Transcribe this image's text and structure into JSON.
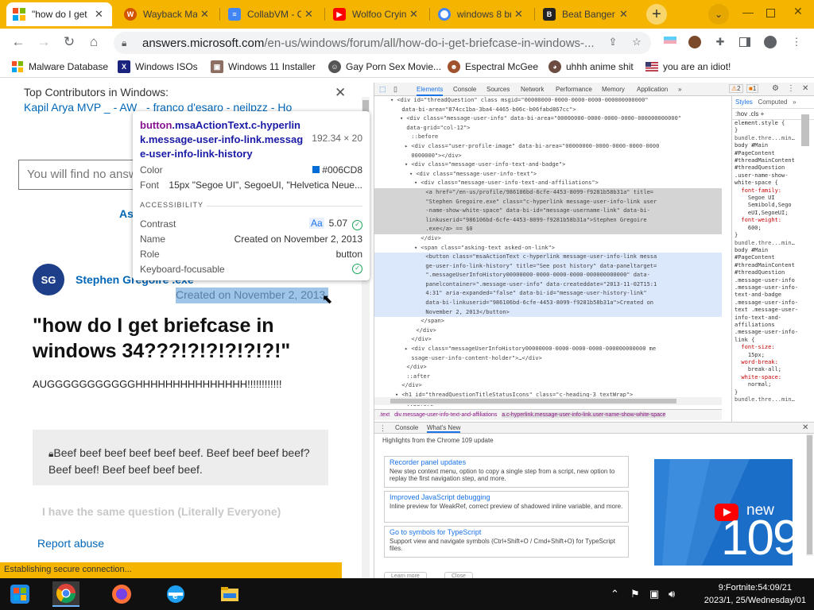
{
  "tabs": [
    {
      "label": "\"how do I get",
      "icon": "microsoft-logo-icon",
      "color": "#f25022",
      "active": true
    },
    {
      "label": "Wayback Ma",
      "icon": "wayback-icon",
      "color": "#d35400"
    },
    {
      "label": "CollabVM - C",
      "icon": "docs-icon",
      "color": "#4285f4"
    },
    {
      "label": "Wolfoo Cryin",
      "icon": "youtube-icon",
      "color": "#ff0000"
    },
    {
      "label": "windows 8 br",
      "icon": "chrome-icon",
      "color": "#4285f4"
    },
    {
      "label": "Beat Banger",
      "icon": "beat-banger-icon",
      "color": "#222222"
    }
  ],
  "toolbar": {
    "url_host": "answers.microsoft.com",
    "url_path": "/en-us/windows/forum/all/how-do-i-get-briefcase-in-windows-..."
  },
  "bookmarks": [
    {
      "label": "Malware Database",
      "icon": "windows-logo-icon"
    },
    {
      "label": "Windows ISOs",
      "icon": "x-icon"
    },
    {
      "label": "Windows 11 Installer",
      "icon": "installer-icon"
    },
    {
      "label": "Gay Porn Sex Movie...",
      "icon": "gay-porn-sex-movie-icon"
    },
    {
      "label": "Espectral McGee",
      "icon": "face-icon"
    },
    {
      "label": "uhhh anime shit",
      "icon": "anime-icon"
    },
    {
      "label": "you are an idiot!",
      "icon": "flag-icon"
    }
  ],
  "page": {
    "contributors_heading": "Top Contributors in Windows:",
    "contributors_links": "Kapil Arya MVP _ - AW_ - franco d'esaro - neilpzz - Ho",
    "search_placeholder": "You will find no answ",
    "ask_label": "As",
    "avatar_initials": "SG",
    "author": "Stephen Gregoire .exe",
    "created": "Created on November 2, 2013",
    "question_title": "\"how do I get briefcase in windows 34???!?!?!?!?!?!\"",
    "question_body": "AUGGGGGGGGGGGHHHHHHHHHHHHHHH!!!!!!!!!!!!",
    "quote": "Beef beef beef beef beef beef. Beef beef beef beef? Beef beef! Beef beef beef beef.",
    "same_question": "I have the same question (Literally Everyone)",
    "report": "Report abuse"
  },
  "status_bar": "Establishing secure connection...",
  "tooltip": {
    "selector_tag": "button",
    "selector_class": ".msaActionText.c-hyperlink.message-user-info-link.message-user-info-link-history",
    "dims": "192.34 × 20",
    "color_label": "Color",
    "color_value": "#006CD8",
    "font_label": "Font",
    "font_value": "15px \"Segoe UI\", SegoeUI, \"Helvetica Neue...",
    "accessibility_heading": "ACCESSIBILITY",
    "contrast_label": "Contrast",
    "contrast_aa": "Aa",
    "contrast_value": "5.07",
    "name_label": "Name",
    "name_value": "Created on November 2, 2013",
    "role_label": "Role",
    "role_value": "button",
    "keyboard_label": "Keyboard-focusable"
  },
  "devtools": {
    "tabs": [
      "Elements",
      "Console",
      "Sources",
      "Network",
      "Performance",
      "Memory",
      "Application",
      "»"
    ],
    "issues": "2",
    "warnings": "1",
    "styles_tabs": [
      "Styles",
      "Computed",
      "»"
    ],
    "styles_filter": ":hov .cls +",
    "element_lines": [
      "<div id=\"threadQuestion\" class msgid=\"00000000-0000-0000-0000-000000000000\"",
      "data-bi-area=\"874cc1ba-3ba4-4465-b06c-b06fabd867cc\">",
      "<div class=\"message-user-info\" data-bi-area=\"00000000-0000-0000-0000-000000000000\"",
      "data-grid=\"col-12\">",
      "::before",
      "<div class=\"user-profile-image\" data-bi-area=\"00000000-0000-0000-0000-0000",
      "0000000\"></div>",
      "<div class=\"message-user-info-text-and-badge\">",
      "<div class=\"message-user-info-text\">",
      "<div class=\"message-user-info-text-and-affiliations\">",
      "<a href=\"/en-us/profile/986106bd-6cfe-4453-8099-f9281b58b31a\" title=",
      "\"Stephen Gregoire.exe\" class=\"c-hyperlink message-user-info-link user",
      "-name-show-white-space\" data-bi-id=\"message-username-link\" data-bi-",
      "linkuserid=\"986106bd-6cfe-4453-8099-f9281b58b31a\">Stephen Gregoire",
      ".exe</a> == $0",
      "</div>",
      "<span class=\"asking-text asked-on-link\">",
      "<button class=\"msaActionText c-hyperlink message-user-info-link messa",
      "ge-user-info-link-history\" title=\"See post history\" data-paneltarget=",
      "\".messageUserInfoHistory00000000-0000-0000-0000-000000000000\" data-",
      "panelcontainer=\".message-user-info\" data-createddate=\"2013-11-02T15:1",
      "4:31\" aria-expanded=\"false\" data-bi-id=\"message-user-history-link\"",
      "data-bi-linkuserid=\"986106bd-6cfe-4453-8099-f9281b58b31a\">Created on",
      "November 2, 2013</button>",
      "</span>",
      "</div>",
      "</div>",
      "<div class=\"messageUserInfoHistory00000000-0000-0000-0000-000000000000 me",
      "ssage-user-info-content-holder\">…</div>",
      "</div>",
      "::after",
      "</div>",
      "<h1 id=\"threadQuestionTitleStatusIcons\" class=\"c-heading-3 textWrap\">",
      "::before"
    ],
    "style_lines": [
      "element.style {",
      "}",
      "bundle.thre...min…",
      "body #Main",
      "#PageContent",
      "#threadMainContent",
      "#threadQuestion",
      ".user-name-show-",
      "white-space {",
      "  font-family:",
      "    Segoe UI",
      "    Semibold,Sego",
      "    eUI,SegoeUI;",
      "  font-weight:",
      "    600;",
      "}",
      "bundle.thre...min…",
      "body #Main",
      "#PageContent",
      "#threadMainContent",
      "#threadQuestion",
      ".message-user-info",
      ".message-user-info-",
      "text-and-badge",
      ".message-user-info-",
      "text .message-user-",
      "info-text-and-",
      "affiliations",
      ".message-user-info-",
      "link {",
      "  font-size:",
      "    15px;",
      "  word-break:",
      "    break-all;",
      "  white-space:",
      "    normal;",
      "}",
      "bundle.thre...min…"
    ],
    "breadcrumb": [
      ".text",
      "div.message-user-info-text-and-affiliations",
      "a.c-hyperlink.message-user-info-link.user-name-show-white-space"
    ],
    "drawer_tabs": [
      "Console",
      "What's New"
    ],
    "drawer_header": "Highlights from the Chrome 109 update",
    "cards": [
      {
        "title": "Recorder panel updates",
        "text": "New step context menu, option to copy a single step from a script, new option to replay the first navigation step, and more."
      },
      {
        "title": "Improved JavaScript debugging",
        "text": "Inline preview for WeakRef, correct preview of shadowed inline variable, and more."
      },
      {
        "title": "Go to symbols for TypeScript",
        "text": "Support view and navigate symbols (Ctrl+Shift+O / Cmd+Shift+O) for TypeScript files."
      }
    ],
    "promo_new": "new",
    "promo_num": "109",
    "learn_more": "Learn more",
    "close": "Close"
  },
  "taskbar": {
    "clock_time": "9:Fortnite:54:09/21",
    "clock_date": "2023/1, 25/Wednesday/01",
    "apps": [
      "windows-start-icon",
      "chrome-icon",
      "firefox-icon",
      "ie-icon",
      "file-explorer-icon"
    ]
  },
  "colors": {
    "tabstrip": "#f4b400",
    "link": "#0067b8",
    "tooltip_swatch": "#006CD8"
  }
}
